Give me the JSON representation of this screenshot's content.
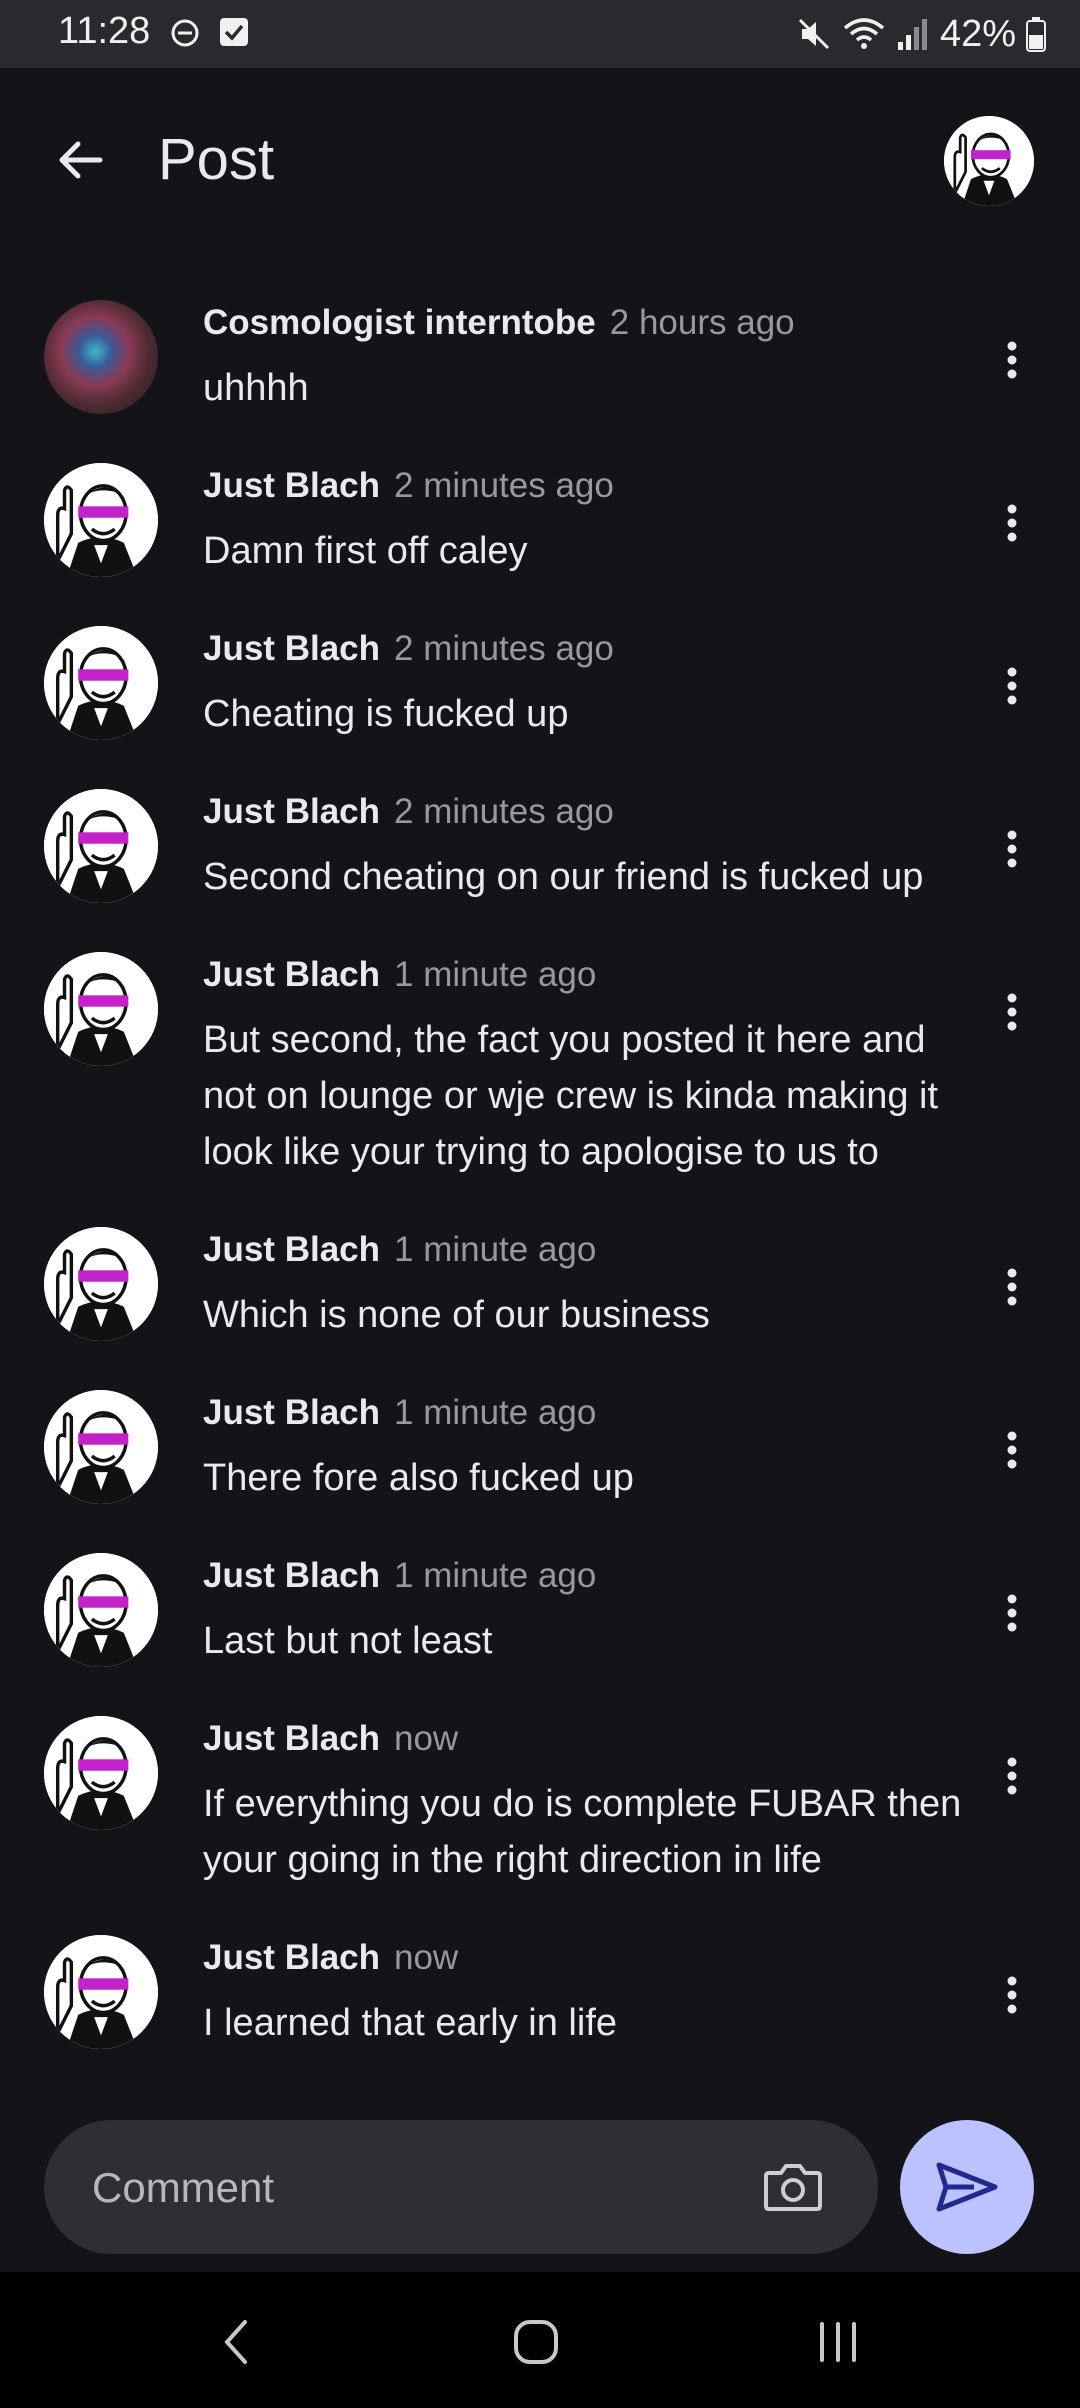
{
  "status_bar": {
    "time": "11:28",
    "battery": "42%"
  },
  "header": {
    "title": "Post",
    "back_icon": "arrow-left-icon"
  },
  "comments": [
    {
      "author": "Cosmologist interntobe",
      "time": "2 hours ago",
      "text": "uhhhh",
      "avatar": "space"
    },
    {
      "author": "Just Blach",
      "time": "2 minutes ago",
      "text": "Damn first off caley",
      "avatar": "sketch"
    },
    {
      "author": "Just Blach",
      "time": "2 minutes ago",
      "text": "Cheating is fucked up",
      "avatar": "sketch"
    },
    {
      "author": "Just Blach",
      "time": "2 minutes ago",
      "text": "Second cheating on our friend is fucked up",
      "avatar": "sketch"
    },
    {
      "author": "Just Blach",
      "time": "1 minute ago",
      "text": "But second, the fact you posted it here and not on lounge or wje crew is kinda making it look like your trying to apologise to us to",
      "avatar": "sketch"
    },
    {
      "author": "Just Blach",
      "time": "1 minute ago",
      "text": "Which is none of our business",
      "avatar": "sketch"
    },
    {
      "author": "Just Blach",
      "time": "1 minute ago",
      "text": "There fore also fucked up",
      "avatar": "sketch"
    },
    {
      "author": "Just Blach",
      "time": "1 minute ago",
      "text": "Last but not least",
      "avatar": "sketch"
    },
    {
      "author": "Just Blach",
      "time": "now",
      "text": "If everything you do is complete FUBAR then your going in the right direction in life",
      "avatar": "sketch"
    },
    {
      "author": "Just Blach",
      "time": "now",
      "text": "I learned that early in life",
      "avatar": "sketch"
    }
  ],
  "compose": {
    "placeholder": "Comment"
  },
  "colors": {
    "background": "#131318",
    "accent": "#bcc2ff",
    "status_bar": "#2a2a2e"
  }
}
